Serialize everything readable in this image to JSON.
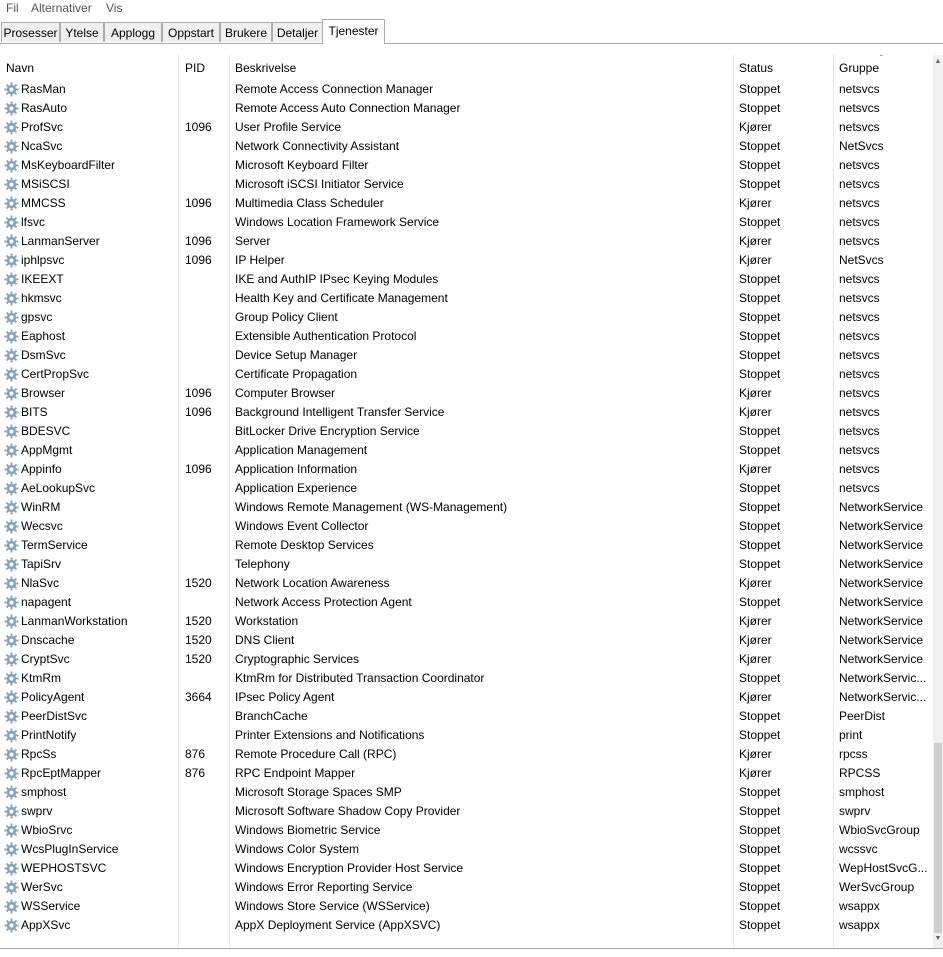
{
  "menu": [
    "Fil",
    "Alternativer",
    "Vis"
  ],
  "tabs": [
    "Prosesser",
    "Ytelse",
    "Applogg",
    "Oppstart",
    "Brukere",
    "Detaljer",
    "Tjenester"
  ],
  "active_tab": "Tjenester",
  "columns": {
    "name": "Navn",
    "pid": "PID",
    "description": "Beskrivelse",
    "status": "Status",
    "group": "Gruppe"
  },
  "sort_indicator": "ˆ",
  "icons": {
    "service": "gear-icon",
    "scroll_up": "▲",
    "scroll_down": "▼"
  },
  "colors": {
    "gear": "#8aa2b8",
    "tab_border": "#acacac",
    "tab_bg": "#f0f0f0"
  },
  "rows": [
    {
      "name": "RasMan",
      "pid": "",
      "description": "Remote Access Connection Manager",
      "status": "Stoppet",
      "group": "netsvcs"
    },
    {
      "name": "RasAuto",
      "pid": "",
      "description": "Remote Access Auto Connection Manager",
      "status": "Stoppet",
      "group": "netsvcs"
    },
    {
      "name": "ProfSvc",
      "pid": "1096",
      "description": "User Profile Service",
      "status": "Kjører",
      "group": "netsvcs"
    },
    {
      "name": "NcaSvc",
      "pid": "",
      "description": "Network Connectivity Assistant",
      "status": "Stoppet",
      "group": "NetSvcs"
    },
    {
      "name": "MsKeyboardFilter",
      "pid": "",
      "description": "Microsoft Keyboard Filter",
      "status": "Stoppet",
      "group": "netsvcs"
    },
    {
      "name": "MSiSCSI",
      "pid": "",
      "description": "Microsoft iSCSI Initiator Service",
      "status": "Stoppet",
      "group": "netsvcs"
    },
    {
      "name": "MMCSS",
      "pid": "1096",
      "description": "Multimedia Class Scheduler",
      "status": "Kjører",
      "group": "netsvcs"
    },
    {
      "name": "lfsvc",
      "pid": "",
      "description": "Windows Location Framework Service",
      "status": "Stoppet",
      "group": "netsvcs"
    },
    {
      "name": "LanmanServer",
      "pid": "1096",
      "description": "Server",
      "status": "Kjører",
      "group": "netsvcs"
    },
    {
      "name": "iphlpsvc",
      "pid": "1096",
      "description": "IP Helper",
      "status": "Kjører",
      "group": "NetSvcs"
    },
    {
      "name": "IKEEXT",
      "pid": "",
      "description": "IKE and AuthIP IPsec Keying Modules",
      "status": "Stoppet",
      "group": "netsvcs"
    },
    {
      "name": "hkmsvc",
      "pid": "",
      "description": "Health Key and Certificate Management",
      "status": "Stoppet",
      "group": "netsvcs"
    },
    {
      "name": "gpsvc",
      "pid": "",
      "description": "Group Policy Client",
      "status": "Stoppet",
      "group": "netsvcs"
    },
    {
      "name": "Eaphost",
      "pid": "",
      "description": "Extensible Authentication Protocol",
      "status": "Stoppet",
      "group": "netsvcs"
    },
    {
      "name": "DsmSvc",
      "pid": "",
      "description": "Device Setup Manager",
      "status": "Stoppet",
      "group": "netsvcs"
    },
    {
      "name": "CertPropSvc",
      "pid": "",
      "description": "Certificate Propagation",
      "status": "Stoppet",
      "group": "netsvcs"
    },
    {
      "name": "Browser",
      "pid": "1096",
      "description": "Computer Browser",
      "status": "Kjører",
      "group": "netsvcs"
    },
    {
      "name": "BITS",
      "pid": "1096",
      "description": "Background Intelligent Transfer Service",
      "status": "Kjører",
      "group": "netsvcs"
    },
    {
      "name": "BDESVC",
      "pid": "",
      "description": "BitLocker Drive Encryption Service",
      "status": "Stoppet",
      "group": "netsvcs"
    },
    {
      "name": "AppMgmt",
      "pid": "",
      "description": "Application Management",
      "status": "Stoppet",
      "group": "netsvcs"
    },
    {
      "name": "Appinfo",
      "pid": "1096",
      "description": "Application Information",
      "status": "Kjører",
      "group": "netsvcs"
    },
    {
      "name": "AeLookupSvc",
      "pid": "",
      "description": "Application Experience",
      "status": "Stoppet",
      "group": "netsvcs"
    },
    {
      "name": "WinRM",
      "pid": "",
      "description": "Windows Remote Management (WS-Management)",
      "status": "Stoppet",
      "group": "NetworkService"
    },
    {
      "name": "Wecsvc",
      "pid": "",
      "description": "Windows Event Collector",
      "status": "Stoppet",
      "group": "NetworkService"
    },
    {
      "name": "TermService",
      "pid": "",
      "description": "Remote Desktop Services",
      "status": "Stoppet",
      "group": "NetworkService"
    },
    {
      "name": "TapiSrv",
      "pid": "",
      "description": "Telephony",
      "status": "Stoppet",
      "group": "NetworkService"
    },
    {
      "name": "NlaSvc",
      "pid": "1520",
      "description": "Network Location Awareness",
      "status": "Kjører",
      "group": "NetworkService"
    },
    {
      "name": "napagent",
      "pid": "",
      "description": "Network Access Protection Agent",
      "status": "Stoppet",
      "group": "NetworkService"
    },
    {
      "name": "LanmanWorkstation",
      "pid": "1520",
      "description": "Workstation",
      "status": "Kjører",
      "group": "NetworkService"
    },
    {
      "name": "Dnscache",
      "pid": "1520",
      "description": "DNS Client",
      "status": "Kjører",
      "group": "NetworkService"
    },
    {
      "name": "CryptSvc",
      "pid": "1520",
      "description": "Cryptographic Services",
      "status": "Kjører",
      "group": "NetworkService"
    },
    {
      "name": "KtmRm",
      "pid": "",
      "description": "KtmRm for Distributed Transaction Coordinator",
      "status": "Stoppet",
      "group": "NetworkServic..."
    },
    {
      "name": "PolicyAgent",
      "pid": "3664",
      "description": "IPsec Policy Agent",
      "status": "Kjører",
      "group": "NetworkServic..."
    },
    {
      "name": "PeerDistSvc",
      "pid": "",
      "description": "BranchCache",
      "status": "Stoppet",
      "group": "PeerDist"
    },
    {
      "name": "PrintNotify",
      "pid": "",
      "description": "Printer Extensions and Notifications",
      "status": "Stoppet",
      "group": "print"
    },
    {
      "name": "RpcSs",
      "pid": "876",
      "description": "Remote Procedure Call (RPC)",
      "status": "Kjører",
      "group": "rpcss"
    },
    {
      "name": "RpcEptMapper",
      "pid": "876",
      "description": "RPC Endpoint Mapper",
      "status": "Kjører",
      "group": "RPCSS"
    },
    {
      "name": "smphost",
      "pid": "",
      "description": "Microsoft Storage Spaces SMP",
      "status": "Stoppet",
      "group": "smphost"
    },
    {
      "name": "swprv",
      "pid": "",
      "description": "Microsoft Software Shadow Copy Provider",
      "status": "Stoppet",
      "group": "swprv"
    },
    {
      "name": "WbioSrvc",
      "pid": "",
      "description": "Windows Biometric Service",
      "status": "Stoppet",
      "group": "WbioSvcGroup"
    },
    {
      "name": "WcsPlugInService",
      "pid": "",
      "description": "Windows Color System",
      "status": "Stoppet",
      "group": "wcssvc"
    },
    {
      "name": "WEPHOSTSVC",
      "pid": "",
      "description": "Windows Encryption Provider Host Service",
      "status": "Stoppet",
      "group": "WepHostSvcG..."
    },
    {
      "name": "WerSvc",
      "pid": "",
      "description": "Windows Error Reporting Service",
      "status": "Stoppet",
      "group": "WerSvcGroup"
    },
    {
      "name": "WSService",
      "pid": "",
      "description": "Windows Store Service (WSService)",
      "status": "Stoppet",
      "group": "wsappx"
    },
    {
      "name": "AppXSvc",
      "pid": "",
      "description": "AppX Deployment Service (AppXSVC)",
      "status": "Stoppet",
      "group": "wsappx"
    }
  ]
}
